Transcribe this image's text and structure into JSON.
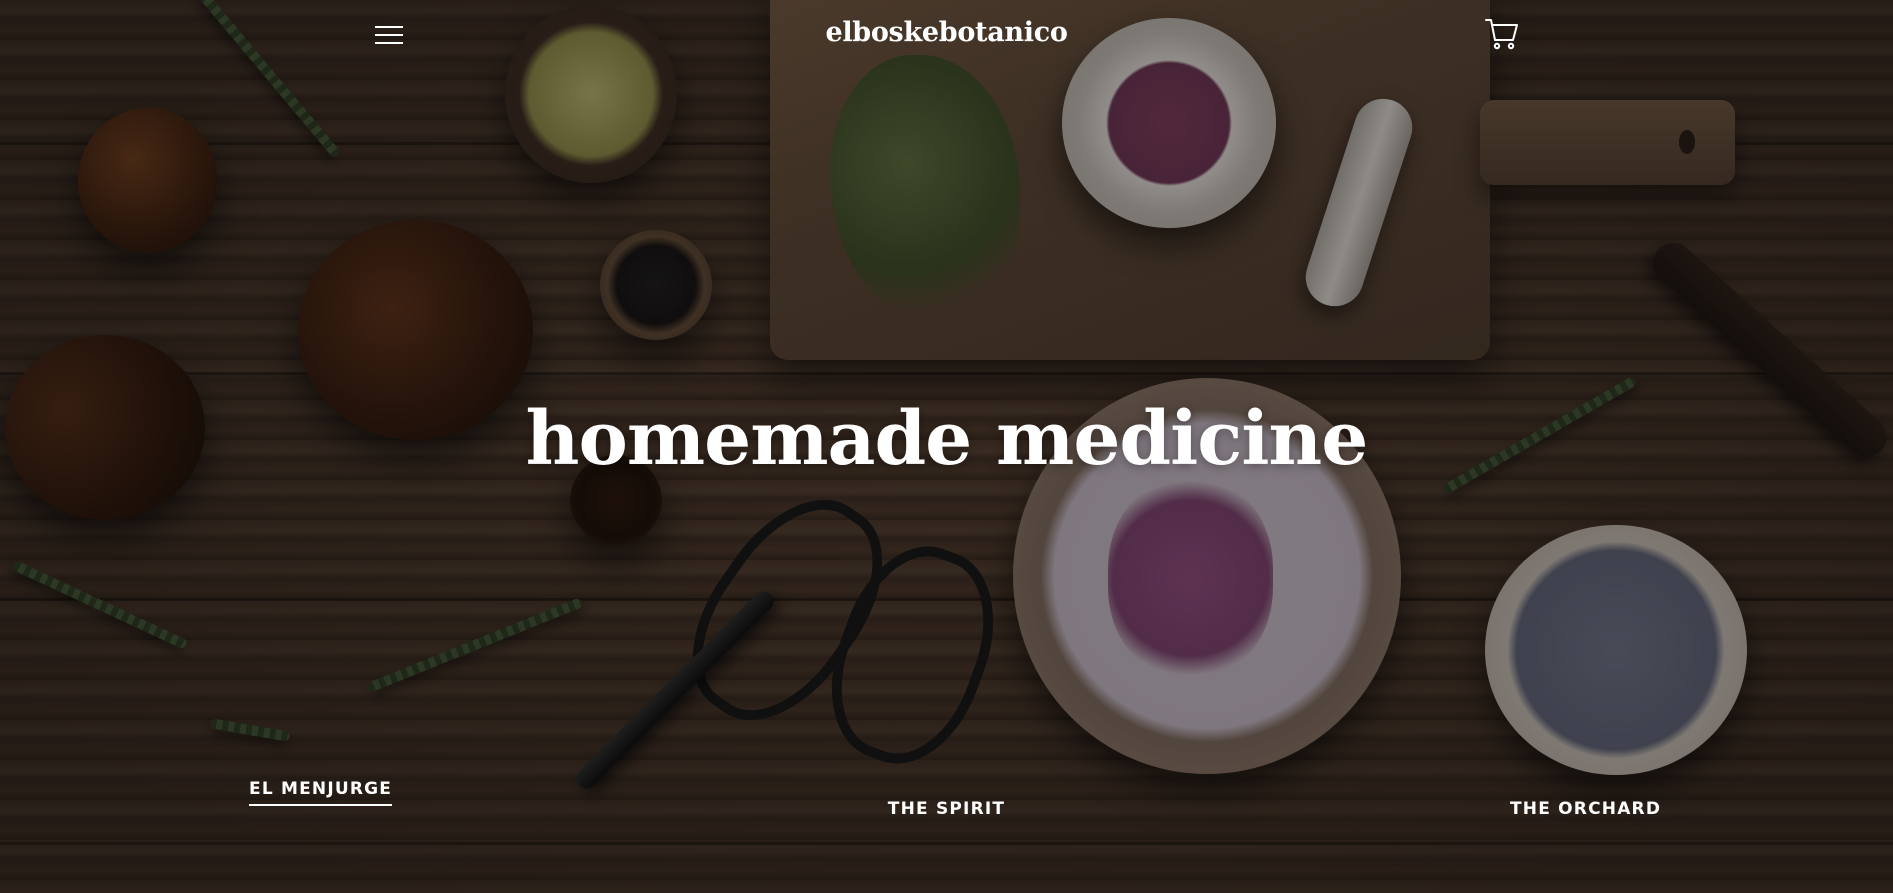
{
  "header": {
    "site_title": "elboskebotanico",
    "menu_icon": "hamburger-menu-icon",
    "cart_icon": "shopping-cart-icon"
  },
  "hero": {
    "title": "homemade medicine"
  },
  "nav": {
    "items": [
      {
        "label": "EL MENJURGE",
        "active": true
      },
      {
        "label": "THE SPIRIT",
        "active": false
      },
      {
        "label": "THE ORCHARD",
        "active": false
      }
    ]
  },
  "colors": {
    "text": "#ffffff",
    "overlay": "#0a080c",
    "wood": "#45332a"
  }
}
